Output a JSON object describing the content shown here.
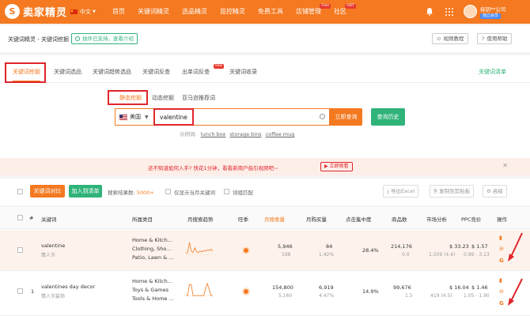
{
  "nav": {
    "logo_mark": "S",
    "logo_text": "卖家精灵",
    "logo_sub": "SELLER",
    "lang": "中文",
    "menu": [
      {
        "label": "首页"
      },
      {
        "label": "关键词精灵"
      },
      {
        "label": "选品精灵"
      },
      {
        "label": "监控精灵"
      },
      {
        "label": "免费工具"
      },
      {
        "label": "店铺管理",
        "tag": "Free"
      },
      {
        "label": "社区",
        "tag": "HOT"
      }
    ],
    "user": "探钥**公司",
    "vip": "独立会员"
  },
  "header": {
    "breadcrumb": "关键词精灵 - 关键词挖掘",
    "plugin_badge": "插件已支持，查看介绍",
    "video_btn": "视频教程",
    "help_btn": "使用帮助"
  },
  "tabs": [
    {
      "label": "关键词挖掘"
    },
    {
      "label": "关键词选品"
    },
    {
      "label": "关键词趋势选品"
    },
    {
      "label": "关键词反查"
    },
    {
      "label": "出单词反查",
      "tag": "new"
    },
    {
      "label": "关键词收录"
    }
  ],
  "word_list": "关键词清单",
  "subtabs": [
    "静态挖掘",
    "动态挖掘",
    "亚马逊推荐词"
  ],
  "search": {
    "country": "美国",
    "value": "valentine",
    "submit": "立即查询",
    "history": "查询历史",
    "examples_label": "示例词:",
    "examples": [
      "lunch box",
      "storage bins",
      "coffee mug"
    ]
  },
  "notice": {
    "text": "还不知道如何入手? 快花1分钟，看看新用户指引视频吧~",
    "button": "立即观看"
  },
  "toolbar": {
    "compare_btn": "关键词对比",
    "add_list_btn": "加入到清单",
    "results_label": "搜索结果数:",
    "results_count": "5000+",
    "only_new": "仅显示当月关键词",
    "exact_match": "词组匹配",
    "export": "导出Excel",
    "copy": "复制到剪贴板",
    "advanced": "高级"
  },
  "table": {
    "headers": [
      "#",
      "关键词",
      "所属类目",
      "月搜索趋势",
      "旺季",
      "月搜索量",
      "月购买量",
      "点击集中度",
      "商品数",
      "市场分析",
      "PPC竞价",
      "操作"
    ],
    "rows": [
      {
        "index": "",
        "keyword": "valentine",
        "translation": "情人节",
        "categories": [
          "Home & Kitch...",
          "Clothing, Sho...",
          "Patio, Lawn & ..."
        ],
        "search_volume": "5,946",
        "search_sub": "198",
        "purchases": "84",
        "purchase_rate": "1.42%",
        "click_concentration": "28.4%",
        "products": "214,176",
        "products_sub": "0.0",
        "price": "$ 33.23",
        "ratings": "1,509 (4.4)",
        "ppc": "$ 1.57",
        "ppc_range": "0.99 - 3.13",
        "trend": [
          0.15,
          0.2,
          0.95,
          0.3,
          0.2,
          0.55,
          0.25,
          0.2,
          0.3,
          0.25,
          0.35,
          0.3,
          0.4,
          0.35,
          0.45,
          0.3
        ]
      },
      {
        "index": "1",
        "keyword": "valentines day decor",
        "translation": "情人节装饰",
        "categories": [
          "Home & Kitch...",
          "Toys & Games",
          "Tools & Home ..."
        ],
        "search_volume": "154,800",
        "search_sub": "5,160",
        "purchases": "6,919",
        "purchase_rate": "4.47%",
        "click_concentration": "14.9%",
        "products": "99,676",
        "products_sub": "1.5",
        "price": "$ 16.04",
        "ratings": "419 (4.5)",
        "ppc": "$ 1.46",
        "ppc_range": "1.05 - 1.90",
        "trend": [
          0.05,
          0.05,
          0.9,
          0.85,
          0.05,
          0.05,
          0.05,
          0.05,
          0.05,
          0.05,
          0.05,
          0.6,
          0.95,
          0.5,
          0.05,
          0.05
        ]
      }
    ]
  },
  "colors": {
    "brand": "#f47920",
    "green": "#2fb379",
    "red": "#e0262b"
  }
}
